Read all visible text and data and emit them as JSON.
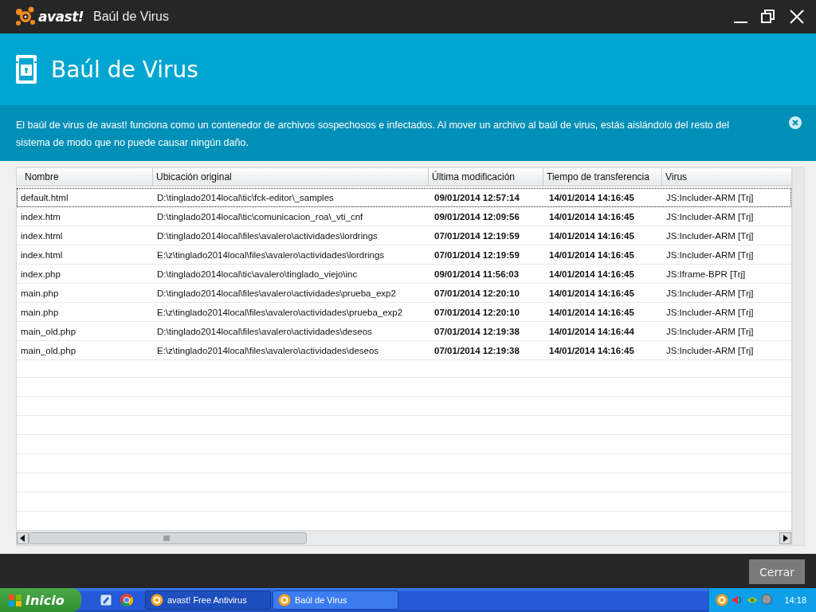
{
  "window": {
    "brand": "avast!",
    "title": "Baúl de Virus"
  },
  "header": {
    "title": "Baúl de Virus"
  },
  "info": {
    "text": "El baúl de virus de avast! funciona como un contenedor de archivos sospechosos e infectados. Al mover un archivo al baúl de virus, estás aislándolo del resto del sistema de modo que no puede causar ningún daño."
  },
  "table": {
    "columns": [
      "Nombre",
      "Ubicación original",
      "Última modificación",
      "Tiempo de transferencia",
      "Virus"
    ],
    "rows": [
      {
        "cells": [
          "default.html",
          "D:\\tinglado2014local\\tic\\fck-editor\\_samples",
          "09/01/2014 12:57:14",
          "14/01/2014 14:16:45",
          "JS:Includer-ARM [Trj]"
        ],
        "selected": true
      },
      {
        "cells": [
          "index.htm",
          "D:\\tinglado2014local\\tic\\comunicacion_roa\\_vti_cnf",
          "09/01/2014 12:09:56",
          "14/01/2014 14:16:45",
          "JS:Includer-ARM [Trj]"
        ],
        "selected": false
      },
      {
        "cells": [
          "index.html",
          "D:\\tinglado2014local\\files\\avalero\\actividades\\lordrings",
          "07/01/2014 12:19:59",
          "14/01/2014 14:16:45",
          "JS:Includer-ARM [Trj]"
        ],
        "selected": false
      },
      {
        "cells": [
          "index.html",
          "E:\\z\\tinglado2014local\\files\\avalero\\actividades\\lordrings",
          "07/01/2014 12:19:59",
          "14/01/2014 14:16:45",
          "JS:Includer-ARM [Trj]"
        ],
        "selected": false
      },
      {
        "cells": [
          "index.php",
          "D:\\tinglado2014local\\tic\\avalero\\tinglado_viejo\\inc",
          "09/01/2014 11:56:03",
          "14/01/2014 14:16:45",
          "JS:Iframe-BPR [Trj]"
        ],
        "selected": false
      },
      {
        "cells": [
          "main.php",
          "D:\\tinglado2014local\\files\\avalero\\actividades\\prueba_exp2",
          "07/01/2014 12:20:10",
          "14/01/2014 14:16:45",
          "JS:Includer-ARM [Trj]"
        ],
        "selected": false
      },
      {
        "cells": [
          "main.php",
          "E:\\z\\tinglado2014local\\files\\avalero\\actividades\\prueba_exp2",
          "07/01/2014 12:20:10",
          "14/01/2014 14:16:45",
          "JS:Includer-ARM [Trj]"
        ],
        "selected": false
      },
      {
        "cells": [
          "main_old.php",
          "D:\\tinglado2014local\\files\\avalero\\actividades\\deseos",
          "07/01/2014 12:19:38",
          "14/01/2014 14:16:44",
          "JS:Includer-ARM [Trj]"
        ],
        "selected": false
      },
      {
        "cells": [
          "main_old.php",
          "E:\\z\\tinglado2014local\\files\\avalero\\actividades\\deseos",
          "07/01/2014 12:19:38",
          "14/01/2014 14:16:45",
          "JS:Includer-ARM [Trj]"
        ],
        "selected": false
      }
    ]
  },
  "footer": {
    "button": "Cerrar"
  },
  "taskbar": {
    "start": "Inicio",
    "tasks": [
      {
        "label": "avast! Free Antivirus",
        "selected": true
      },
      {
        "label": "Baúl de Virus",
        "selected": false
      }
    ],
    "clock": "14:18"
  }
}
